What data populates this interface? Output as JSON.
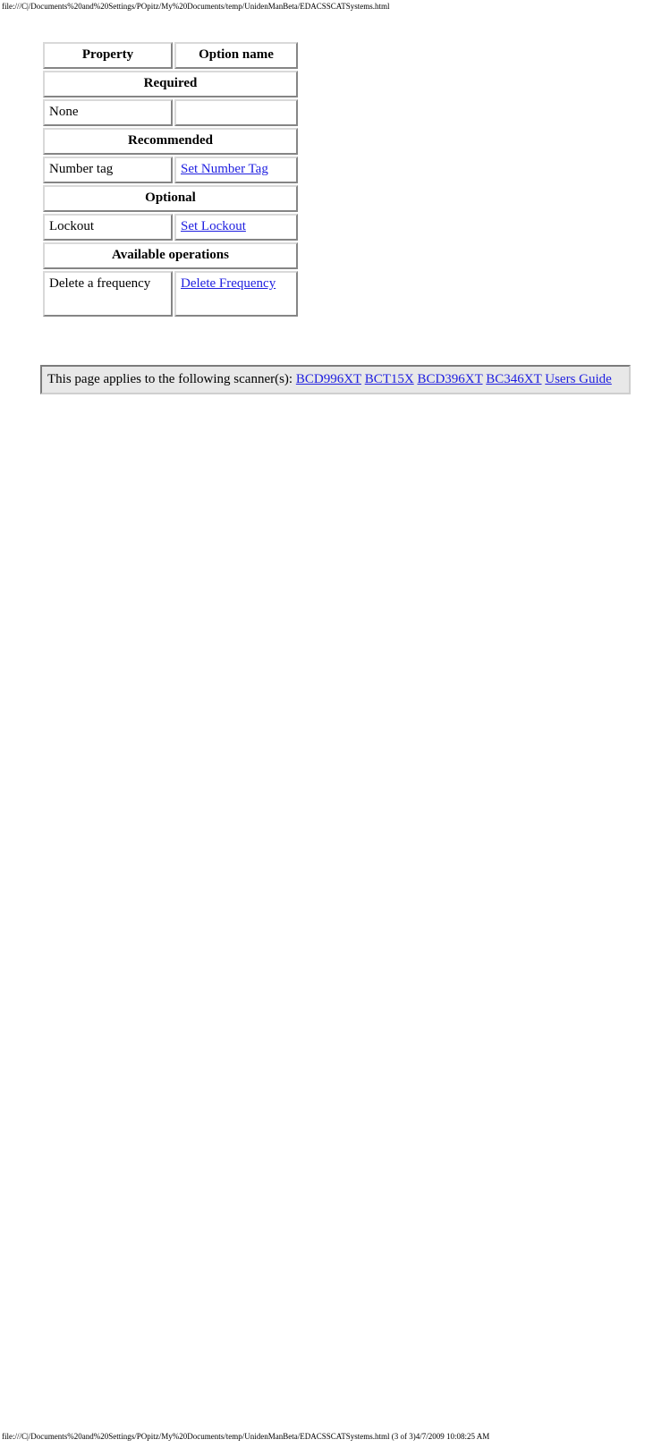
{
  "chrome": {
    "header_url": "file:///C|/Documents%20and%20Settings/POpitz/My%20Documents/temp/UnidenManBeta/EDACSSCATSystems.html",
    "footer_url": "file:///C|/Documents%20and%20Settings/POpitz/My%20Documents/temp/UnidenManBeta/EDACSSCATSystems.html (3 of 3)4/7/2009 10:08:25 AM"
  },
  "table": {
    "headers": {
      "property": "Property",
      "option_name": "Option name"
    },
    "sections": [
      {
        "band": "Required",
        "band_color": "#ccffcc",
        "rows": [
          {
            "property": "None",
            "option_name": "",
            "option_is_link": false
          }
        ]
      },
      {
        "band": "Recommended",
        "band_color": "#fac28c",
        "rows": [
          {
            "property": "Number tag",
            "option_name": "Set Number Tag",
            "option_is_link": true
          }
        ]
      },
      {
        "band": "Optional",
        "band_color": "#fbc9c9",
        "rows": [
          {
            "property": "Lockout",
            "option_name": "Set Lockout",
            "option_is_link": true
          }
        ]
      },
      {
        "band": "Available operations",
        "band_color": "#7b68ee",
        "rows": [
          {
            "property": "Delete a frequency",
            "option_name": "Delete Frequency",
            "option_is_link": true
          }
        ]
      }
    ]
  },
  "applies_to": {
    "intro": "This page applies to the following scanner(s):",
    "links": [
      "BCD996XT",
      "BCT15X",
      "BCD396XT",
      "BC346XT",
      "Users Guide"
    ]
  },
  "colors": {
    "link": "#2020e0",
    "box_background": "#e8e8e8",
    "page_background": "#ffffff"
  }
}
